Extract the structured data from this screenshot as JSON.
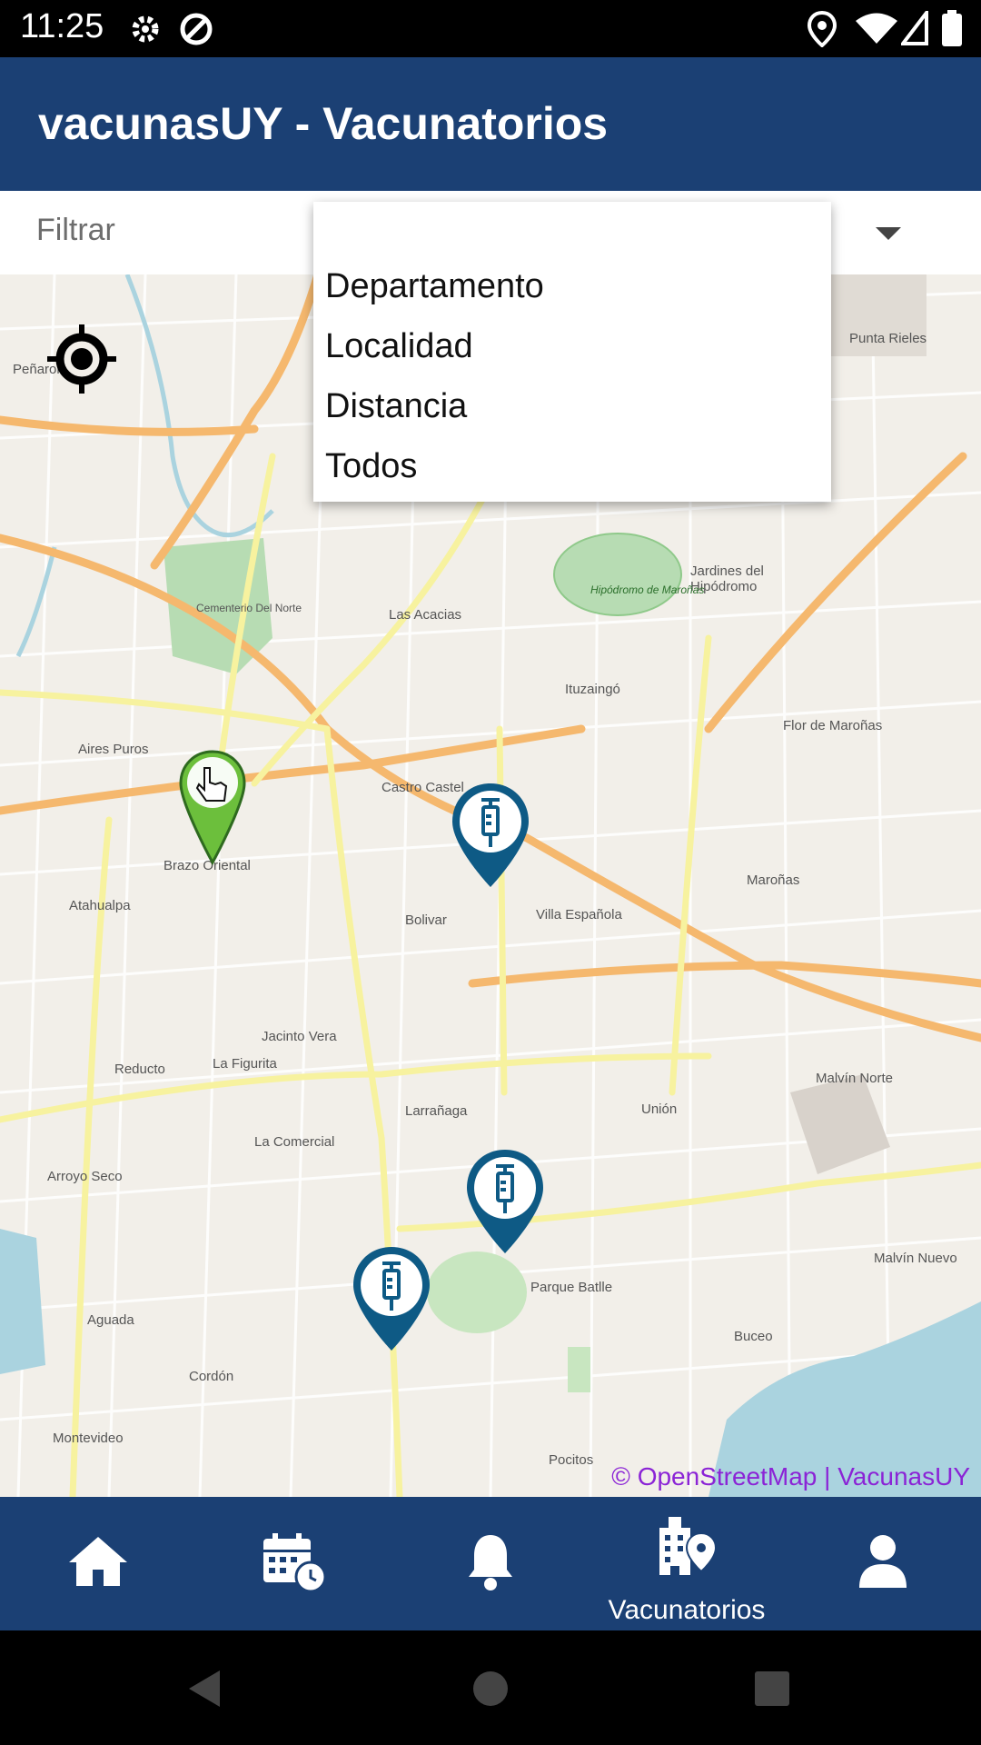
{
  "status_bar": {
    "time": "11:25"
  },
  "app_bar": {
    "title": "vacunasUY - Vacunatorios"
  },
  "filter": {
    "label": "Filtrar"
  },
  "dropdown": {
    "options": [
      "Departamento",
      "Localidad",
      "Distancia",
      "Todos"
    ]
  },
  "map": {
    "attribution": "© OpenStreetMap | VacunasUY",
    "places": [
      "Peñarol",
      "Punta Rieles",
      "Jardines del Hipódromo",
      "Las Acacias",
      "Ituzaingó",
      "Flor de Maroñas",
      "Aires Puros",
      "Castro Castel",
      "Brazo Oriental",
      "Maroñas",
      "Atahualpa",
      "Bolivar",
      "Villa Española",
      "Jacinto Vera",
      "Reducto",
      "La Figurita",
      "Malvín Norte",
      "Larrañaga",
      "Unión",
      "La Comercial",
      "Arroyo Seco",
      "Parque Batlle",
      "Malvín Nuevo",
      "Aguada",
      "Cordón",
      "Buceo",
      "Montevideo",
      "Pocitos",
      "Cementerio Del Norte",
      "Hipódromo de Maroñas"
    ],
    "markers": [
      {
        "name": "user-location",
        "icon": "hand-pointer-icon"
      },
      {
        "name": "vacunatorio-1",
        "icon": "syringe-icon"
      },
      {
        "name": "vacunatorio-2",
        "icon": "syringe-icon"
      },
      {
        "name": "vacunatorio-3",
        "icon": "syringe-icon"
      }
    ]
  },
  "bottom_nav": {
    "items": [
      {
        "icon": "home-icon",
        "label": ""
      },
      {
        "icon": "calendar-icon",
        "label": ""
      },
      {
        "icon": "bell-icon",
        "label": ""
      },
      {
        "icon": "vacunatorios-icon",
        "label": "Vacunatorios"
      },
      {
        "icon": "user-icon",
        "label": ""
      }
    ]
  },
  "colors": {
    "primary": "#1b4074",
    "marker_blue": "#0e5a85",
    "user_marker": "#6cbf3c",
    "attribution": "#8b24d6"
  }
}
